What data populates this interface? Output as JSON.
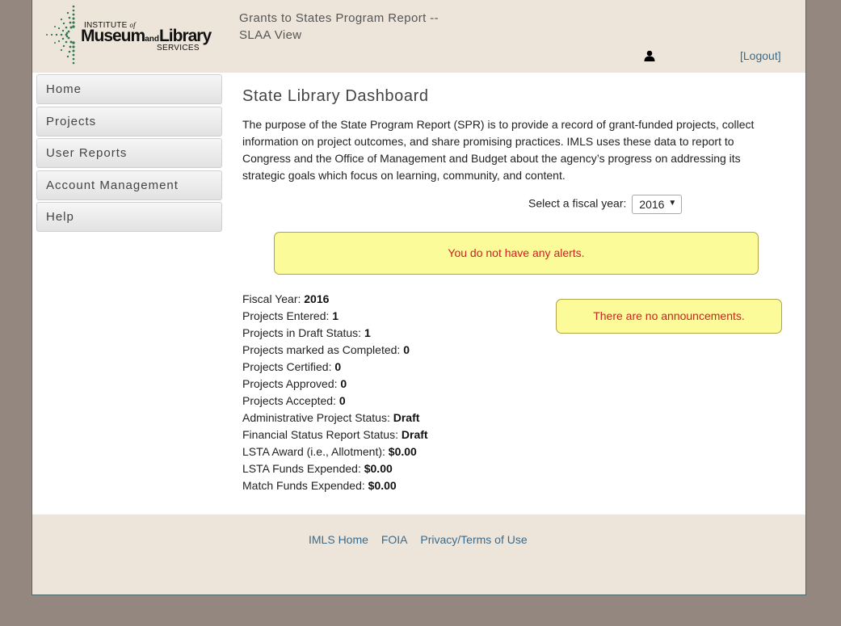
{
  "header": {
    "logo": {
      "line1": "INSTITUTE",
      "line1_of": "of",
      "museum": "Museum",
      "and": "and",
      "library": "Library",
      "services": "SERVICES"
    },
    "title_line1": "Grants to States Program Report --",
    "title_line2": "SLAA View",
    "user_icon": "user-icon",
    "logout": "[Logout]"
  },
  "sidebar": {
    "items": [
      {
        "label": "Home"
      },
      {
        "label": "Projects"
      },
      {
        "label": "User Reports"
      },
      {
        "label": "Account Management"
      },
      {
        "label": "Help"
      }
    ]
  },
  "main": {
    "title": "State Library Dashboard",
    "intro": "The purpose of the State Program Report (SPR) is to provide a record of grant-funded projects, collect information on project outcomes, and share promising practices. IMLS uses these data to report to Congress and the Office of Management and Budget about the agency’s progress on addressing its strategic goals which focus on learning, community, and content.",
    "fiscal_year_label": "Select a fiscal year:",
    "fiscal_year_value": "2016",
    "alerts_text": "You do not have any alerts.",
    "announcements_text": "There are no announcements.",
    "stats": [
      {
        "label": "Fiscal Year:",
        "value": "2016"
      },
      {
        "label": "Projects Entered:",
        "value": "1"
      },
      {
        "label": "Projects in Draft Status:",
        "value": "1"
      },
      {
        "label": "Projects marked as Completed:",
        "value": "0"
      },
      {
        "label": "Projects Certified:",
        "value": "0"
      },
      {
        "label": "Projects Approved:",
        "value": "0"
      },
      {
        "label": "Projects Accepted:",
        "value": "0"
      },
      {
        "label": "Administrative Project Status:",
        "value": "Draft"
      },
      {
        "label": "Financial Status Report Status:",
        "value": "Draft"
      },
      {
        "label": "LSTA Award (i.e., Allotment):",
        "value": "$0.00"
      },
      {
        "label": "LSTA Funds Expended:",
        "value": "$0.00"
      },
      {
        "label": "Match Funds Expended:",
        "value": "$0.00"
      }
    ]
  },
  "footer": {
    "links": [
      {
        "label": "IMLS Home"
      },
      {
        "label": "FOIA"
      },
      {
        "label": "Privacy/Terms of Use"
      }
    ]
  },
  "colors": {
    "background": "#94877f",
    "header_bg": "#ede5da",
    "alert_bg": "#fbfb9a",
    "alert_text": "#cc2222",
    "link": "#3a6a8a"
  }
}
